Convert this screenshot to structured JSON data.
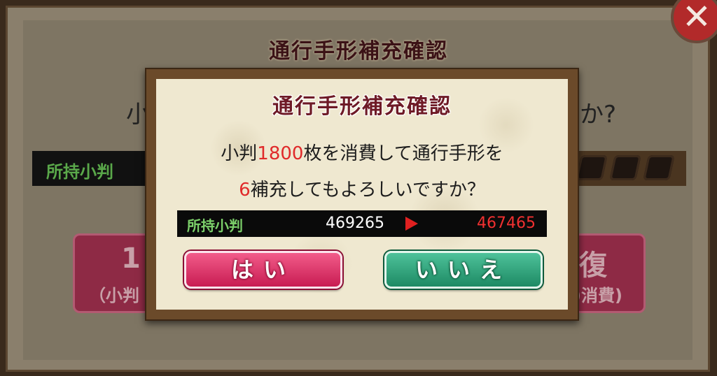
{
  "background": {
    "title": "通行手形補充確認",
    "question_left": "小",
    "question_right": "か?",
    "koban_label": "所持小判",
    "left_button": {
      "big": "1",
      "small": "（小判"
    },
    "right_button": {
      "big": "復",
      "small": ")消費)"
    },
    "close_glyph": "✕"
  },
  "dialog": {
    "title": "通行手形補充確認",
    "line1": {
      "prefix": "小判",
      "amount": "1800",
      "suffix": "枚を消費して通行手形を"
    },
    "line2": {
      "count": "6",
      "suffix": "補充してもよろしいですか？"
    },
    "balance": {
      "label": "所持小判",
      "current": "469265",
      "after": "467465"
    },
    "buttons": {
      "yes": "はい",
      "no": "いいえ"
    }
  },
  "colors": {
    "highlight_red": "#e02a2a",
    "yes_button": "#d8265e",
    "no_button": "#2a9a72",
    "koban_label_green": "#7cd06a"
  },
  "icons": [
    "pass-icon",
    "close-icon",
    "arrow-right-icon"
  ]
}
